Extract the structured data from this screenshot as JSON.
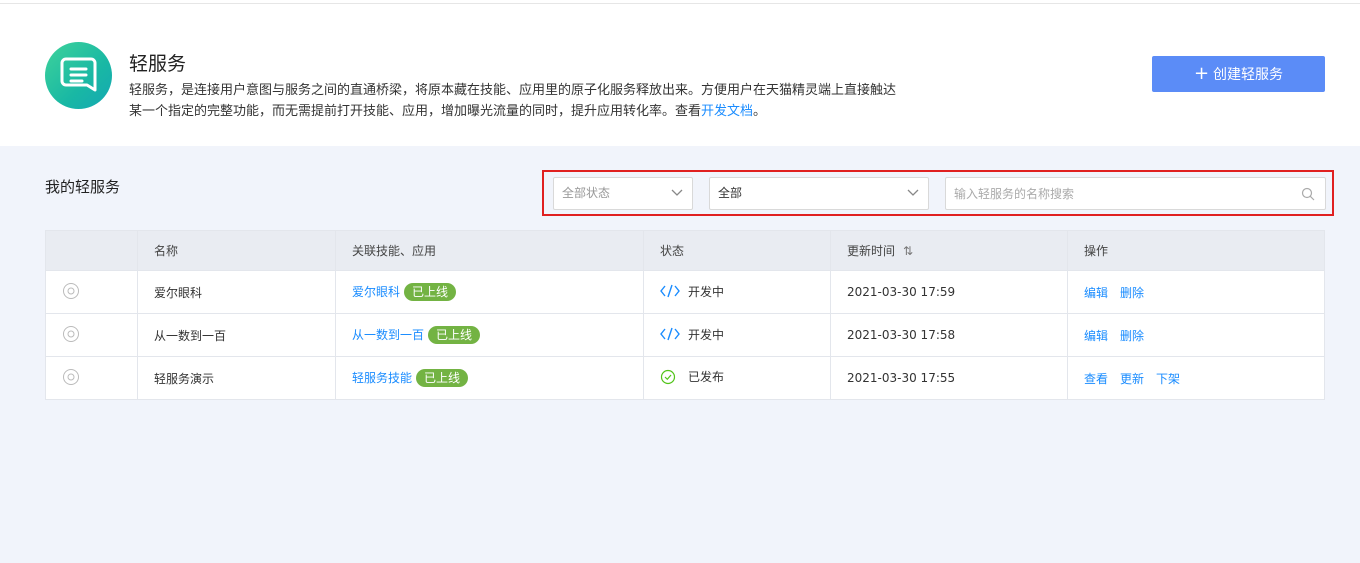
{
  "header": {
    "title": "轻服务",
    "desc_line1": "轻服务，是连接用户意图与服务之间的直通桥梁，将原本藏在技能、应用里的原子化服务释放出来。方便用户在天猫精灵端上直接触达",
    "desc_line2_prefix": "某一个指定的完整功能，而无需提前打开技能、应用，增加曝光流量的同时，提升应用转化率。查看",
    "desc_link": "开发文档",
    "desc_suffix": "。",
    "create_button": "创建轻服务",
    "create_plus": "+"
  },
  "section": {
    "title": "我的轻服务"
  },
  "filters": {
    "status_select": "全部状态",
    "type_select": "全部",
    "search_placeholder": "输入轻服务的名称搜索"
  },
  "table": {
    "headers": [
      "",
      "名称",
      "关联技能、应用",
      "状态",
      "更新时间",
      "操作"
    ],
    "sort_icon": "⇅",
    "rows": [
      {
        "icon": "gear-circle-icon",
        "name": "爱尔眼科",
        "related": "爱尔眼科",
        "badge": "已上线",
        "status": "开发中",
        "status_icon": "code-icon",
        "time": "2021-03-30 17:59",
        "ops": [
          "编辑",
          "删除"
        ]
      },
      {
        "icon": "gear-circle-icon",
        "name": "从一数到一百",
        "related": "从一数到一百",
        "badge": "已上线",
        "status": "开发中",
        "status_icon": "code-icon",
        "time": "2021-03-30 17:58",
        "ops": [
          "编辑",
          "删除"
        ]
      },
      {
        "icon": "gear-circle-icon",
        "name": "轻服务演示",
        "related": "轻服务技能",
        "badge": "已上线",
        "status": "已发布",
        "status_icon": "check-circle-icon",
        "time": "2021-03-30 17:55",
        "ops": [
          "查看",
          "更新",
          "下架"
        ]
      }
    ]
  },
  "colors": {
    "accent": "#5b8cf7",
    "link": "#1a8cff",
    "badge": "#73b343",
    "highlight_border": "#e02020"
  }
}
